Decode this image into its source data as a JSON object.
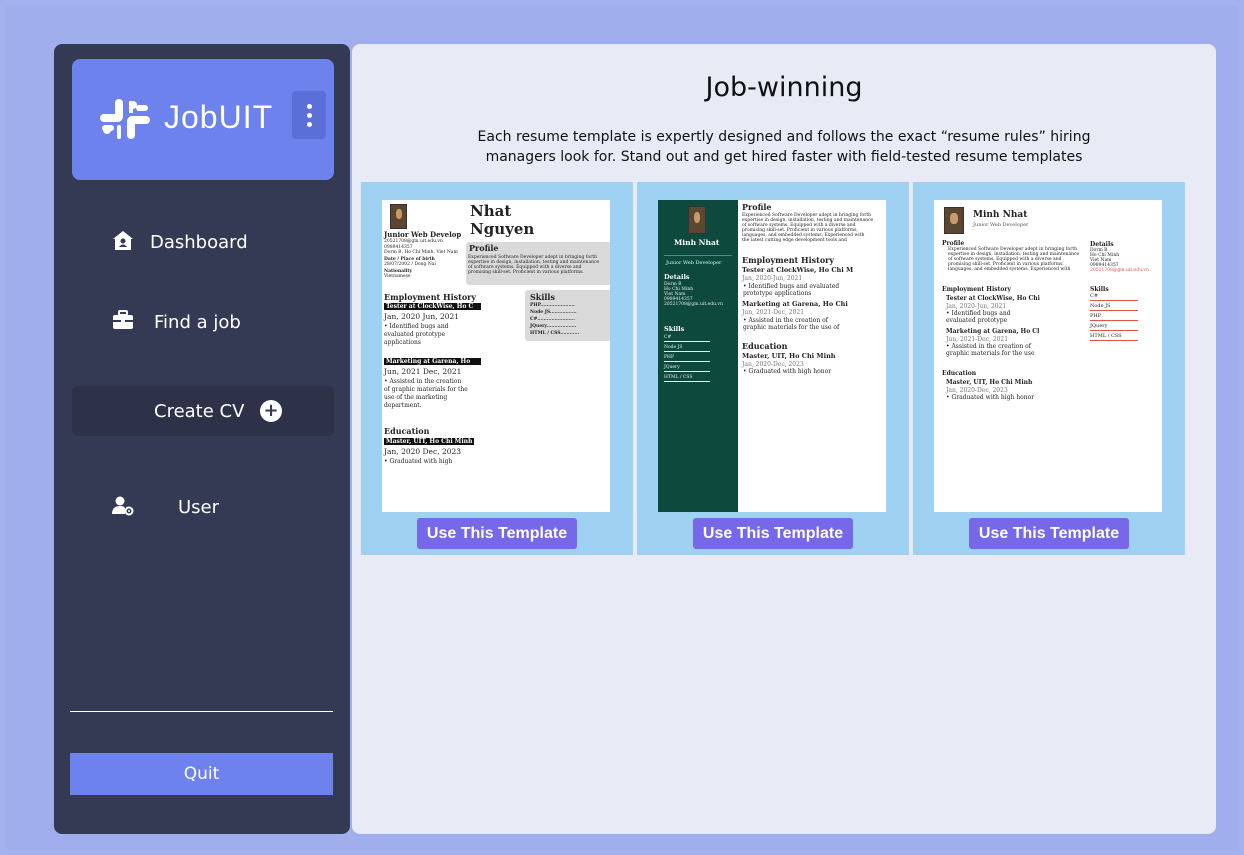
{
  "app": {
    "name": "JobUIT"
  },
  "sidebar": {
    "items": [
      {
        "label": "Dashboard",
        "icon": "home-icon"
      },
      {
        "label": "Find a job",
        "icon": "briefcase-icon"
      },
      {
        "label": "Create CV",
        "icon": "plus-circle-icon"
      },
      {
        "label": "User",
        "icon": "user-gear-icon"
      }
    ],
    "quit_label": "Quit"
  },
  "main": {
    "title": "Job-winning",
    "description": "Each resume template is expertly designed and follows the exact “resume rules” hiring managers look for. Stand out and get hired faster with field-tested resume templates",
    "button_label": "Use This Template"
  },
  "templates": [
    {
      "first_name": "Nhat",
      "last_name": "Nguyen",
      "role": "Junior Web Develop",
      "contact": [
        "20521708@gm.uit.edu.vn",
        "0989414357",
        "Dorm B, Ho Chi Minh, Viet Nam"
      ],
      "dob_label": "Date / Place of birth",
      "dob": "28/07/2002 / Dong Nai",
      "nationality_label": "Nationality",
      "nationality": "Vietnamese",
      "profile_label": "Profile",
      "profile": [
        "Experienced Software Developer adept in bringing forth",
        "expertise in design, installation, testing and maintenance",
        "of software systems. Equipped with a diverse and",
        "promising skill-set. Proficient in various platforms."
      ],
      "employment_label": "Employment History",
      "job1_title": "Tester at ClockWise, Ho C",
      "job1_date": "Jan, 2020 Jun, 2021",
      "job1_desc": [
        "• Identified bugs and",
        "evaluated prototype",
        "applications"
      ],
      "job2_title": "Marketing at Garena, Ho",
      "job2_date": "Jun, 2021 Dec, 2021",
      "job2_desc": [
        "• Assisted in the creation",
        "of graphic materials for the",
        "use of the marketing",
        "department."
      ],
      "education_label": "Education",
      "edu_title": "Master, UIT, Ho Chi Minh",
      "edu_date": "Jan, 2020 Dec, 2023",
      "edu_desc": "• Graduated with high",
      "skills_label": "Skills",
      "skills": [
        "PHP......................",
        "Node JS.................",
        "C#........................",
        "JQuery...................",
        "HTML / CSS............"
      ]
    },
    {
      "name": "Minh Nhat",
      "role": "Junior Web Developer",
      "details_label": "Details",
      "details": [
        "Dorm B",
        "Ho Chi Minh",
        "Viet Nam",
        "0989414357",
        "20521708@gm.uit.edu.vn"
      ],
      "skills_label": "Skills",
      "skills": [
        "C#",
        "Node JS",
        "PHP",
        "JQuery",
        "HTML / CSS"
      ],
      "profile_label": "Profile",
      "profile": [
        "Experienced Software Developer adept in bringing forth",
        "expertise in design, installation, testing and maintenance",
        "of software systems. Equipped with a diverse and",
        "promising skill-set. Proficient in various platforms,",
        "languages, and embedded systems. Experienced with",
        "the latest cutting edge development tools and"
      ],
      "employment_label": "Employment History",
      "job1_title": "Tester at ClockWise, Ho Chi M",
      "job1_date": "Jan, 2020-Jun, 2021",
      "job1_desc": [
        "• Identified bugs and evaluated",
        "prototype applications"
      ],
      "job2_title": "Marketing at Garena, Ho Chi",
      "job2_date": "Jun, 2021-Dec, 2021",
      "job2_desc": [
        "• Assisted in the creation of",
        "graphic materials for the use of"
      ],
      "education_label": "Education",
      "edu_title": "Master, UIT, Ho Chi Minh",
      "edu_date": "Jan, 2020-Dec, 2023",
      "edu_desc": "• Graduated with high honor"
    },
    {
      "name": "Minh Nhat",
      "role": "Junior Web Developer",
      "profile_label": "Profile",
      "profile": [
        "Experienced Software Developer adept in bringing forth",
        "expertise in design, installation, testing and maintenance",
        "of software systems. Equipped with a diverse and",
        "promising skill-set. Proficient in various platforms,",
        "languages, and embedded systems. Experienced with"
      ],
      "details_label": "Details",
      "details": [
        "Dorm B",
        "Ho Chi Minh",
        "Viet Nam",
        "0989414357"
      ],
      "email": "20521708@gm.uit.edu.vn",
      "employment_label": "Employment History",
      "job1_title": "Tester at ClockWise, Ho Chi",
      "job1_date": "Jan, 2020-Jun, 2021",
      "job1_desc": [
        "• Identified bugs and",
        "evaluated prototype"
      ],
      "job2_title": "Marketing at Garena, Ho Cl",
      "job2_date": "Jun, 2021-Dec, 2021",
      "job2_desc": [
        "• Assisted in the creation of",
        "graphic materials for the use"
      ],
      "skills_label": "Skills",
      "skills": [
        "C#",
        "Node JS",
        "PHP",
        "JQuery",
        "HTML / CSS"
      ],
      "education_label": "Education",
      "edu_title": "Master, UIT, Ho Chi Minh",
      "edu_date": "Jan, 2020-Dec, 2023",
      "edu_desc": "• Graduated with high honor"
    }
  ],
  "colors": {
    "background": "#a4b1ef",
    "sidebar": "#353a54",
    "accent": "#6d82ec",
    "main_panel": "#e8ebf5",
    "card": "#9fd1f3",
    "button": "#7768ea",
    "template2_sidebar": "#0d4a3d",
    "email_red": "#e0524a"
  }
}
